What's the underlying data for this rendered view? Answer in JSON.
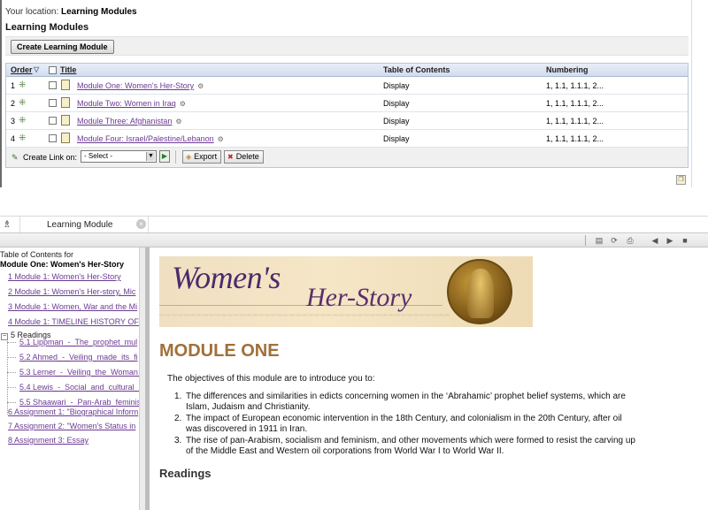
{
  "top": {
    "breadcrumb_prefix": "Your location:",
    "breadcrumb_current": "Learning Modules",
    "title": "Learning Modules",
    "create_button": "Create Learning Module",
    "columns": {
      "order": "Order",
      "title": "Title",
      "toc": "Table of Contents",
      "numbering": "Numbering"
    },
    "rows": [
      {
        "order": "1",
        "title": "Module One: Women's Her-Story",
        "toc": "Display",
        "numbering": "1, 1.1, 1.1.1, 2..."
      },
      {
        "order": "2",
        "title": "Module Two: Women in Iraq",
        "toc": "Display",
        "numbering": "1, 1.1, 1.1.1, 2..."
      },
      {
        "order": "3",
        "title": "Module Three: Afghanistan",
        "toc": "Display",
        "numbering": "1, 1.1, 1.1.1, 2..."
      },
      {
        "order": "4",
        "title": "Module Four: Israel/Palestine/Lebanon",
        "toc": "Display",
        "numbering": "1, 1.1, 1.1.1, 2..."
      }
    ],
    "footer": {
      "create_link_label": "Create Link on:",
      "select_value": "- Select -",
      "export_button": "Export",
      "delete_button": "Delete"
    }
  },
  "viewer": {
    "tab_label": "Learning Module",
    "toc": {
      "header": "Table of Contents for",
      "module_name": "Module One: Women's Her-Story",
      "items": [
        {
          "label": "1 Module 1: Women's Her-Story",
          "level": 0,
          "type": "link"
        },
        {
          "label": "2 Module 1: Women's Her-story, Mic",
          "level": 0,
          "type": "link"
        },
        {
          "label": "3 Module 1: Women, War and the Mi",
          "level": 0,
          "type": "link"
        },
        {
          "label": "4 Module 1: TIMELINE HISTORY OF T",
          "level": 0,
          "type": "link"
        },
        {
          "label": "5 Readings",
          "level": 0,
          "type": "folder"
        },
        {
          "label": "5.1 Lippman_-_The_prophet_mul",
          "level": 1,
          "type": "link"
        },
        {
          "label": "5.2 Ahmed_-_Veiling_made_its_fi",
          "level": 1,
          "type": "link"
        },
        {
          "label": "5.3 Lerner_-_Veiling_the_Woman_",
          "level": 1,
          "type": "link"
        },
        {
          "label": "5.4 Lewis_-_Social_and_cultural_b",
          "level": 1,
          "type": "link"
        },
        {
          "label": "5.5 Shaawari_-_Pan-Arab_feminis",
          "level": 1,
          "type": "link"
        },
        {
          "label": "6 Assignment 1: \"Biographical Inform",
          "level": 0,
          "type": "link"
        },
        {
          "label": "7 Assignment 2: \"Women's Status in",
          "level": 0,
          "type": "link"
        },
        {
          "label": "8 Assignment 3: Essay",
          "level": 0,
          "type": "link"
        }
      ]
    },
    "content": {
      "banner_word1": "Women's",
      "banner_word2": "Her-Story",
      "heading": "MODULE ONE",
      "intro": "The objectives of this module are to introduce you to:",
      "objectives": [
        {
          "num": "1.",
          "line1": "The differences and similarities in edicts concerning women in the ‘Abrahamic’ prophet belief systems, which are",
          "line2": "Islam, Judaism and Christianity."
        },
        {
          "num": "2.",
          "line1": "The impact of European economic intervention in the 18th Century, and colonialism in the 20th Century, after oil",
          "line2": "was discovered in 1911 in Iran."
        },
        {
          "num": "3.",
          "line1": "The rise of pan-Arabism, socialism and feminism, and other movements which were formed to resist the carving up",
          "line2": "of the Middle East and Western oil corporations from World War I to World War II."
        }
      ],
      "readings_heading": "Readings"
    }
  },
  "colors": {
    "link_purple": "#6b3a93",
    "heading_brown": "#a0703a",
    "table_header_blue": "#d3dcee"
  },
  "icons": {
    "move": "move-arrows-icon",
    "document": "document-icon",
    "export": "export-icon",
    "delete": "delete-icon",
    "close_tab": "close-tab-icon"
  }
}
